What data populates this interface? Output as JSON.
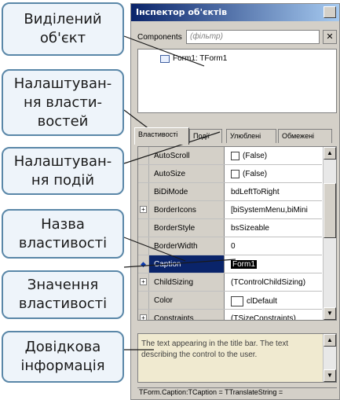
{
  "window": {
    "title": "Інспектор об'єктів"
  },
  "components": {
    "label": "Components",
    "placeholder": "(фільтр)"
  },
  "tree": {
    "node": "Form1: TForm1"
  },
  "tabs": [
    "Властивості",
    "Події",
    "Улюблені",
    "Обмежені"
  ],
  "properties": [
    {
      "name": "AutoScroll",
      "value": "(False)",
      "kind": "checkbox"
    },
    {
      "name": "AutoSize",
      "value": "(False)",
      "kind": "checkbox"
    },
    {
      "name": "BiDiMode",
      "value": "bdLeftToRight",
      "kind": "text"
    },
    {
      "name": "BorderIcons",
      "value": "[biSystemMenu,biMini",
      "kind": "expand"
    },
    {
      "name": "BorderStyle",
      "value": "bsSizeable",
      "kind": "text"
    },
    {
      "name": "BorderWidth",
      "value": "0",
      "kind": "text"
    },
    {
      "name": "Caption",
      "value": "Form1",
      "kind": "selected"
    },
    {
      "name": "ChildSizing",
      "value": "(TControlChildSizing)",
      "kind": "expand"
    },
    {
      "name": "Color",
      "value": "clDefault",
      "kind": "color"
    },
    {
      "name": "Constraints",
      "value": "(TSizeConstraints)",
      "kind": "expand"
    }
  ],
  "help": {
    "text": "The text appearing in the title bar. The text describing the control to the user."
  },
  "status": {
    "text": "TForm.Caption:TCaption = TTranslateString ="
  },
  "callouts": [
    {
      "line1": "Виділений",
      "line2": "об'єкт",
      "line3": ""
    },
    {
      "line1": "Налаштуван-",
      "line2": "ня власти-",
      "line3": "востей"
    },
    {
      "line1": "Налаштуван-",
      "line2": "ня подій",
      "line3": ""
    },
    {
      "line1": "Назва",
      "line2": "властивості",
      "line3": ""
    },
    {
      "line1": "Значення",
      "line2": "властивості",
      "line3": ""
    },
    {
      "line1": "Довідкова",
      "line2": "інформація",
      "line3": ""
    }
  ]
}
